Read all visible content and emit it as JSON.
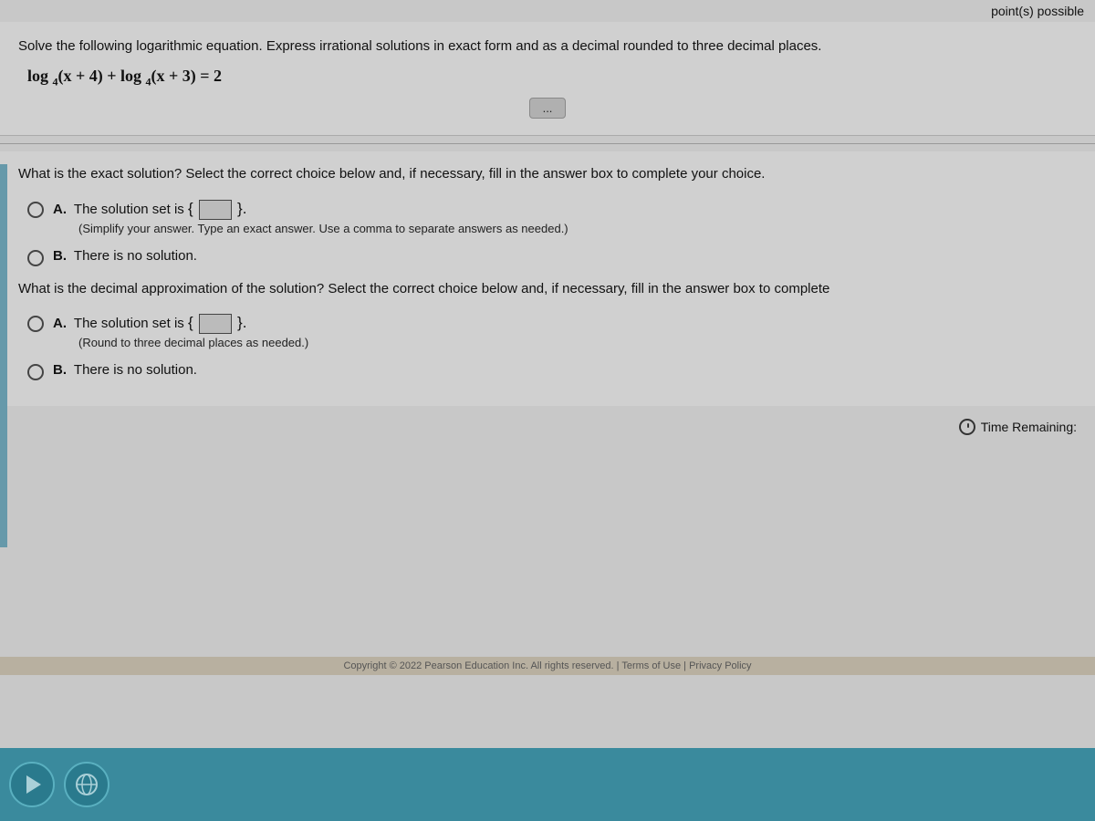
{
  "header": {
    "points_label": "point(s) possible"
  },
  "question": {
    "instruction": "Solve the following logarithmic equation. Express irrational solutions in exact form and as a decimal rounded to three decimal places.",
    "equation_display": "log₄(x+4) + log₄(x+3) = 2",
    "expand_button_label": "..."
  },
  "exact_section": {
    "question_text": "What is the exact solution? Select the correct choice below and, if necessary, fill in the answer box to complete your choice.",
    "choice_a_label": "A.",
    "choice_a_text": "The solution set is",
    "choice_a_note": "(Simplify your answer. Type an exact answer. Use a comma to separate answers as needed.)",
    "choice_b_label": "B.",
    "choice_b_text": "There is no solution."
  },
  "decimal_section": {
    "question_text": "What is the decimal approximation of the solution? Select the correct choice below and, if necessary, fill in the answer box to complete",
    "choice_a_label": "A.",
    "choice_a_text": "The solution set is",
    "choice_a_note": "(Round to three decimal places as needed.)",
    "choice_b_label": "B.",
    "choice_b_text": "There is no solution."
  },
  "footer": {
    "time_remaining_label": "Time Remaining:",
    "copyright_text": "Copyright © 2022 Pearson Education Inc. All rights reserved. | Terms of Use | Privacy Policy"
  },
  "icons": {
    "clock": "clock-icon",
    "expand": "expand-icon",
    "play": "play-icon",
    "browser": "browser-icon"
  }
}
